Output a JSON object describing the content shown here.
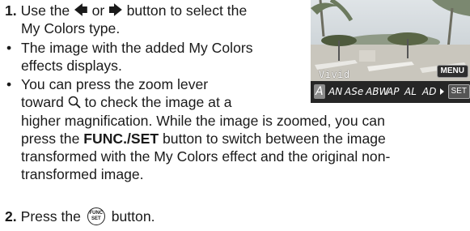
{
  "step1": {
    "number": "1.",
    "text_a": "Use the",
    "left_arrow": "🡄",
    "or": "or",
    "right_arrow": "🡆",
    "text_b": "button to select the",
    "text_c": "My Colors type."
  },
  "bullet1": {
    "bullet": "•",
    "line1": "The image with the added My Colors",
    "line2": "effects displays."
  },
  "bullet2": {
    "bullet": "•",
    "line1": "You can press the zoom lever",
    "line2a": "toward",
    "zoom_glyph": "🔍︎",
    "line2b": "to check the image at a",
    "line3": "higher magnification. While the image is zoomed, you can",
    "line4a": "press the",
    "func_set": "FUNC./SET",
    "line4b": "button to switch between the image",
    "line5": "transformed with the My Colors effect and the original non-",
    "line6": "transformed image."
  },
  "step2": {
    "number": "2.",
    "text_a": "Press the",
    "button_top": "FUNC",
    "button_bottom": "SET",
    "text_b": "button."
  },
  "lcd": {
    "mode_label": "Vivid",
    "menu_label": "MENU",
    "set_label": "SET",
    "options": [
      "A",
      "AN",
      "ASe",
      "ABW",
      "AP",
      "AL",
      "AD"
    ]
  }
}
